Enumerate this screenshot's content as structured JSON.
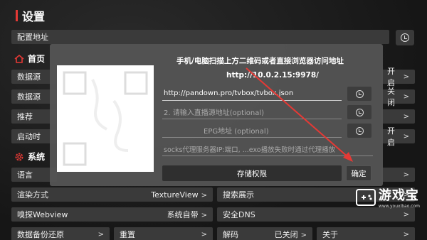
{
  "page": {
    "title": "设置"
  },
  "config": {
    "label": "配置地址"
  },
  "home_section": {
    "title": "首页"
  },
  "system_section": {
    "title": "系统"
  },
  "left_rows": [
    {
      "label": "数据源"
    },
    {
      "label": "数据源"
    },
    {
      "label": "推荐"
    },
    {
      "label": "启动时"
    }
  ],
  "right_rows": [
    {
      "value": "开启"
    },
    {
      "value": "关闭"
    },
    {
      "value": ""
    },
    {
      "value": "开启"
    }
  ],
  "bottom": {
    "language": "语言",
    "render": "渲染方式",
    "render_value": "TextureView",
    "search": "搜索展示",
    "sniff": "嗅探Webview",
    "sniff_value": "系统自带",
    "dns": "安全DNS",
    "backup": "数据备份还原",
    "reset": "重置",
    "decode": "解码",
    "decode_value": "已关闭",
    "about": "关于"
  },
  "dialog": {
    "heading": "手机/电脑扫描上方二维码或者直接浏览器访问地址",
    "url": "http://10.0.2.15:9978/",
    "field1_value": "http://pandown.pro/tvbox/tvbox.json",
    "field2_placeholder": "2. 请输入直播源地址(optional)",
    "field3_placeholder": "EPG地址 (optional)",
    "hint": "socks代理服务器IP:端口, ...exo播放失败时通过代理播放",
    "storage_btn": "存储权限",
    "ok_btn": "确定"
  },
  "watermark": {
    "name": "游戏宝",
    "url": "www.youxibao.com"
  },
  "colors": {
    "accent": "#e53935",
    "arrow": "#e53935"
  }
}
